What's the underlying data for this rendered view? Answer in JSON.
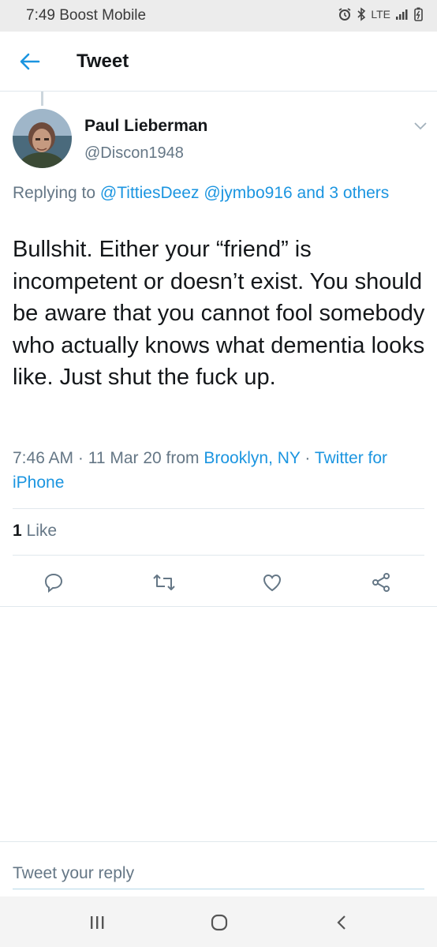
{
  "status_bar": {
    "time_carrier": "7:49 Boost Mobile",
    "network": "LTE",
    "icons": [
      "alarm-icon",
      "bluetooth-icon",
      "signal-icon",
      "battery-icon"
    ]
  },
  "header": {
    "title": "Tweet",
    "back_icon": "arrow-left-icon"
  },
  "tweet": {
    "author_name": "Paul Lieberman",
    "author_handle": "@Discon1948",
    "replying_prefix": "Replying to ",
    "replying_to": [
      "@TittiesDeez",
      "@jymbo916",
      "and 3 others"
    ],
    "body": "Bullshit. Either your “friend” is incompetent or doesn’t exist. You should be aware that you cannot fool somebody who actually knows what dementia looks like. Just shut the fuck up.",
    "timestamp": "7:46 AM · 11 Mar 20 from ",
    "location": "Brooklyn, NY",
    "source_separator": " · ",
    "source": "Twitter for iPhone",
    "like_count": "1",
    "like_label": " Like"
  },
  "actions": [
    "reply-icon",
    "retweet-icon",
    "like-icon",
    "share-icon"
  ],
  "reply": {
    "placeholder": "Tweet your reply"
  },
  "colors": {
    "accent": "#1b95e0",
    "secondary_text": "#657786",
    "divider": "#e1e8ed"
  }
}
